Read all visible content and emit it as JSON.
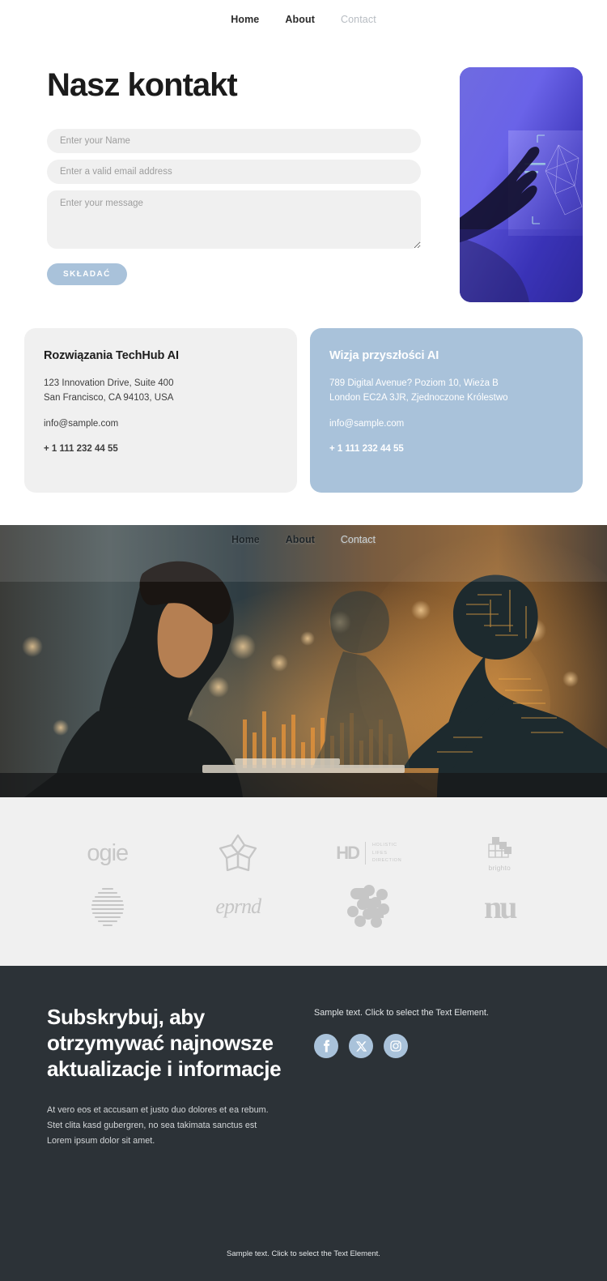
{
  "topnav": {
    "items": [
      {
        "label": "Home",
        "state": "normal"
      },
      {
        "label": "About",
        "state": "normal"
      },
      {
        "label": "Contact",
        "state": "muted"
      }
    ]
  },
  "contact": {
    "title": "Nasz kontakt",
    "form": {
      "name_placeholder": "Enter your Name",
      "name_value": "",
      "email_placeholder": "Enter a valid email address",
      "email_value": "",
      "message_placeholder": "Enter your message",
      "message_value": "",
      "submit_label": "SKŁADAĆ"
    },
    "side_image_alt": "hand-touching-holographic-interface"
  },
  "cards": [
    {
      "title": "Rozwiązania TechHub AI",
      "address_line1": "123 Innovation Drive, Suite 400",
      "address_line2": "San Francisco, CA 94103, USA",
      "email": "info@sample.com",
      "phone": "+ 1 111 232 44 55",
      "theme": "light"
    },
    {
      "title": "Wizja przyszłości AI",
      "address_line1": "789 Digital Avenue? Poziom 10, Wieża B",
      "address_line2": "London EC2A 3JR, Zjednoczone Królestwo",
      "email": "info@sample.com",
      "phone": "+ 1 111 232 44 55",
      "theme": "blue"
    }
  ],
  "hero": {
    "image_alt": "woman-at-keyboard-with-robot-and-golden-city-lights",
    "nav": [
      {
        "label": "Home",
        "state": "normal"
      },
      {
        "label": "About",
        "state": "normal"
      },
      {
        "label": "Contact",
        "state": "muted"
      }
    ]
  },
  "logos": [
    {
      "name": "ogie",
      "type": "wordmark"
    },
    {
      "name": "flower-star",
      "type": "mark"
    },
    {
      "name": "HD",
      "sub": "HOLISTIC\nLIFES\nDIRECTION",
      "type": "hd"
    },
    {
      "name": "brighto",
      "type": "brighto"
    },
    {
      "name": "striped-sphere",
      "type": "mark"
    },
    {
      "name": "eprnd",
      "type": "ambigram"
    },
    {
      "name": "dots-pattern",
      "type": "mark"
    },
    {
      "name": "nu",
      "type": "nu"
    }
  ],
  "footer": {
    "title": "Subskrybuj, aby otrzymywać najnowsze aktualizacje i informacje",
    "body": "At vero eos et accusam et justo duo dolores et ea rebum. Stet clita kasd gubergren, no sea takimata sanctus est Lorem ipsum dolor sit amet.",
    "sample_text": "Sample text. Click to select the Text Element.",
    "socials": [
      {
        "name": "facebook",
        "label": "f"
      },
      {
        "name": "x-twitter",
        "label": "X"
      },
      {
        "name": "instagram",
        "label": "ig"
      }
    ],
    "bottom_text": "Sample text. Click to select the Text Element."
  },
  "colors": {
    "accent": "#a9c2da",
    "footer_bg": "#2c3237",
    "field_bg": "#f0f0f0",
    "logo_gray": "#c6c6c6"
  }
}
